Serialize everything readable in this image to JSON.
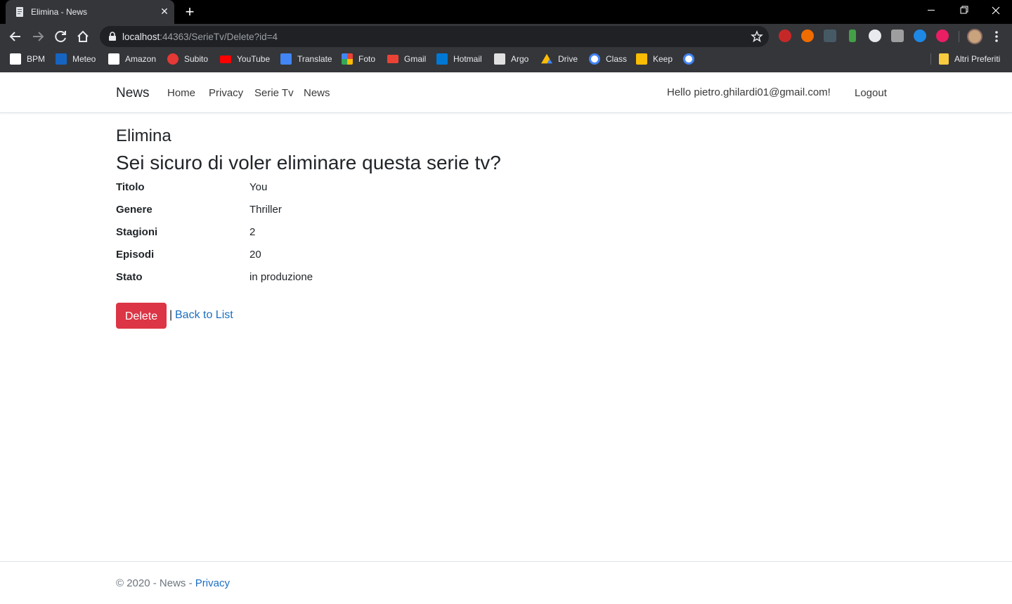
{
  "browser": {
    "tab_title": "Elimina - News",
    "url_host": "localhost",
    "url_path": ":44363/SerieTv/Delete?id=4",
    "bookmarks": [
      {
        "label": "BPM",
        "icon": "bank-icon",
        "color": "#ffffff"
      },
      {
        "label": "Meteo",
        "icon": "weather-icon",
        "color": "#1565c0"
      },
      {
        "label": "Amazon",
        "icon": "amazon-icon",
        "color": "#ffffff"
      },
      {
        "label": "Subito",
        "icon": "subito-icon",
        "color": "#e53935"
      },
      {
        "label": "YouTube",
        "icon": "youtube-icon",
        "color": "#ff0000"
      },
      {
        "label": "Translate",
        "icon": "translate-icon",
        "color": "#4285f4"
      },
      {
        "label": "Foto",
        "icon": "photos-icon",
        "color": "#fbbc05"
      },
      {
        "label": "Gmail",
        "icon": "gmail-icon",
        "color": "#ea4335"
      },
      {
        "label": "Hotmail",
        "icon": "outlook-icon",
        "color": "#0078d4"
      },
      {
        "label": "Argo",
        "icon": "argo-icon",
        "color": "#e0e0e0"
      },
      {
        "label": "Drive",
        "icon": "drive-icon",
        "color": "#0f9d58"
      },
      {
        "label": "Class",
        "icon": "google-icon",
        "color": "#ffffff"
      },
      {
        "label": "Keep",
        "icon": "keep-icon",
        "color": "#fbbc05"
      },
      {
        "label": "",
        "icon": "google-icon",
        "color": "#ffffff"
      }
    ],
    "other_bookmarks": "Altri Preferiti"
  },
  "navbar": {
    "brand": "News",
    "links": [
      "Home",
      "Privacy",
      "Serie Tv",
      "News"
    ],
    "greeting": "Hello pietro.ghilardi01@gmail.com!",
    "logout": "Logout"
  },
  "main": {
    "heading": "Elimina",
    "question": "Sei sicuro di voler eliminare questa serie tv?",
    "details": [
      {
        "label": "Titolo",
        "value": "You"
      },
      {
        "label": "Genere",
        "value": "Thriller"
      },
      {
        "label": "Stagioni",
        "value": "2"
      },
      {
        "label": "Episodi",
        "value": "20"
      },
      {
        "label": "Stato",
        "value": "in produzione"
      }
    ],
    "delete_label": "Delete",
    "separator": "|",
    "back_label": "Back to List"
  },
  "footer": {
    "copyright": "© 2020 - News - ",
    "privacy": "Privacy"
  },
  "colors": {
    "danger": "#dc3545",
    "link": "#1b6ec2",
    "text": "#212529",
    "muted": "#6c757d"
  }
}
